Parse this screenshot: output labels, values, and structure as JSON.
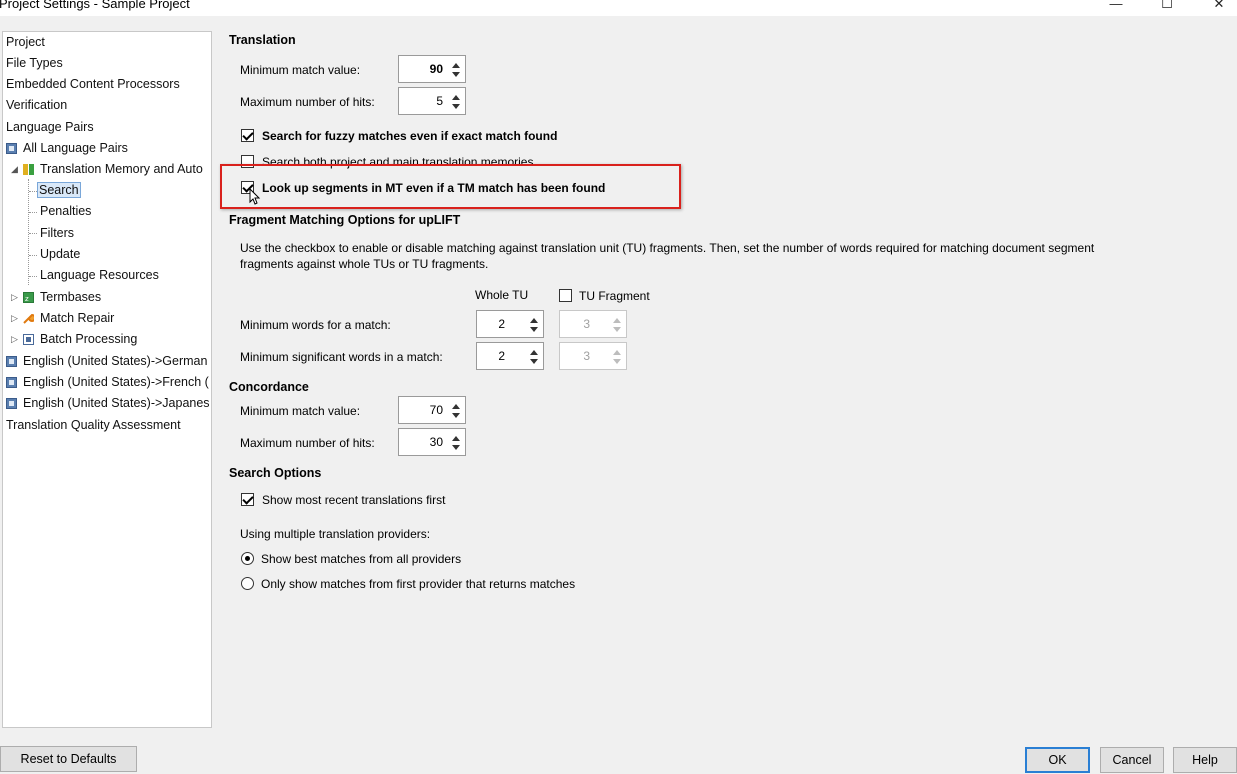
{
  "window": {
    "title": "Project Settings - Sample Project",
    "minimize": "—",
    "maximize": "☐",
    "close": "✕"
  },
  "tree": {
    "items": [
      {
        "label": "Project",
        "icon": null
      },
      {
        "label": "File Types",
        "icon": null
      },
      {
        "label": "Embedded Content Processors",
        "icon": null
      },
      {
        "label": "Verification",
        "icon": null
      },
      {
        "label": "Language Pairs",
        "icon": null
      },
      {
        "label": "All Language Pairs",
        "icon": "language-pair-icon"
      },
      {
        "label": "Translation Memory and Auto",
        "icon": "translation-memory-icon",
        "expanded": true
      },
      {
        "label": "Search",
        "selected": true
      },
      {
        "label": "Penalties"
      },
      {
        "label": "Filters"
      },
      {
        "label": "Update"
      },
      {
        "label": "Language Resources"
      },
      {
        "label": "Termbases",
        "icon": "termbase-icon"
      },
      {
        "label": "Match Repair",
        "icon": "wrench-icon"
      },
      {
        "label": "Batch Processing",
        "icon": "batch-icon"
      },
      {
        "label": "English (United States)->German",
        "icon": "language-pair-icon"
      },
      {
        "label": "English (United States)->French (",
        "icon": "language-pair-icon"
      },
      {
        "label": "English (United States)->Japanes",
        "icon": "language-pair-icon"
      },
      {
        "label": "Translation Quality Assessment",
        "icon": null
      }
    ]
  },
  "translation": {
    "title": "Translation",
    "min_match_label": "Minimum match value:",
    "min_match_value": "90",
    "max_hits_label": "Maximum number of hits:",
    "max_hits_value": "5",
    "fuzzy_label": "Search for fuzzy matches even if exact match found",
    "fuzzy_checked": true,
    "both_tm_label": "Search both project and main translation memories",
    "both_tm_checked": false,
    "mt_lookup_label": "Look up segments in MT even if a TM match has been found",
    "mt_lookup_checked": true
  },
  "fragment": {
    "title": "Fragment Matching Options for upLIFT",
    "description_line1": "Use the checkbox to enable or disable matching against translation unit (TU)  fragments. Then, set the number of words required for matching document segment",
    "description_line2": "fragments against whole TUs or TU fragments.",
    "whole_tu_header": "Whole TU",
    "tu_fragment_label": "TU Fragment",
    "tu_fragment_checked": false,
    "min_words_label": "Minimum words for a match:",
    "min_words_whole": "2",
    "min_words_fragment": "3",
    "min_sig_label": "Minimum significant words in a match:",
    "min_sig_whole": "2",
    "min_sig_fragment": "3"
  },
  "concordance": {
    "title": "Concordance",
    "min_match_label": "Minimum match value:",
    "min_match_value": "70",
    "max_hits_label": "Maximum number of hits:",
    "max_hits_value": "30"
  },
  "search_options": {
    "title": "Search Options",
    "recent_label": "Show most recent translations first",
    "recent_checked": true,
    "providers_label": "Using multiple translation providers:",
    "best_all_label": "Show best matches from all providers",
    "first_provider_label": "Only show matches from first provider that returns matches",
    "selected": "best_all"
  },
  "buttons": {
    "reset": "Reset to Defaults",
    "ok": "OK",
    "cancel": "Cancel",
    "help": "Help"
  },
  "colors": {
    "highlight": "#d9211c",
    "selection": "#d9e8f8"
  }
}
